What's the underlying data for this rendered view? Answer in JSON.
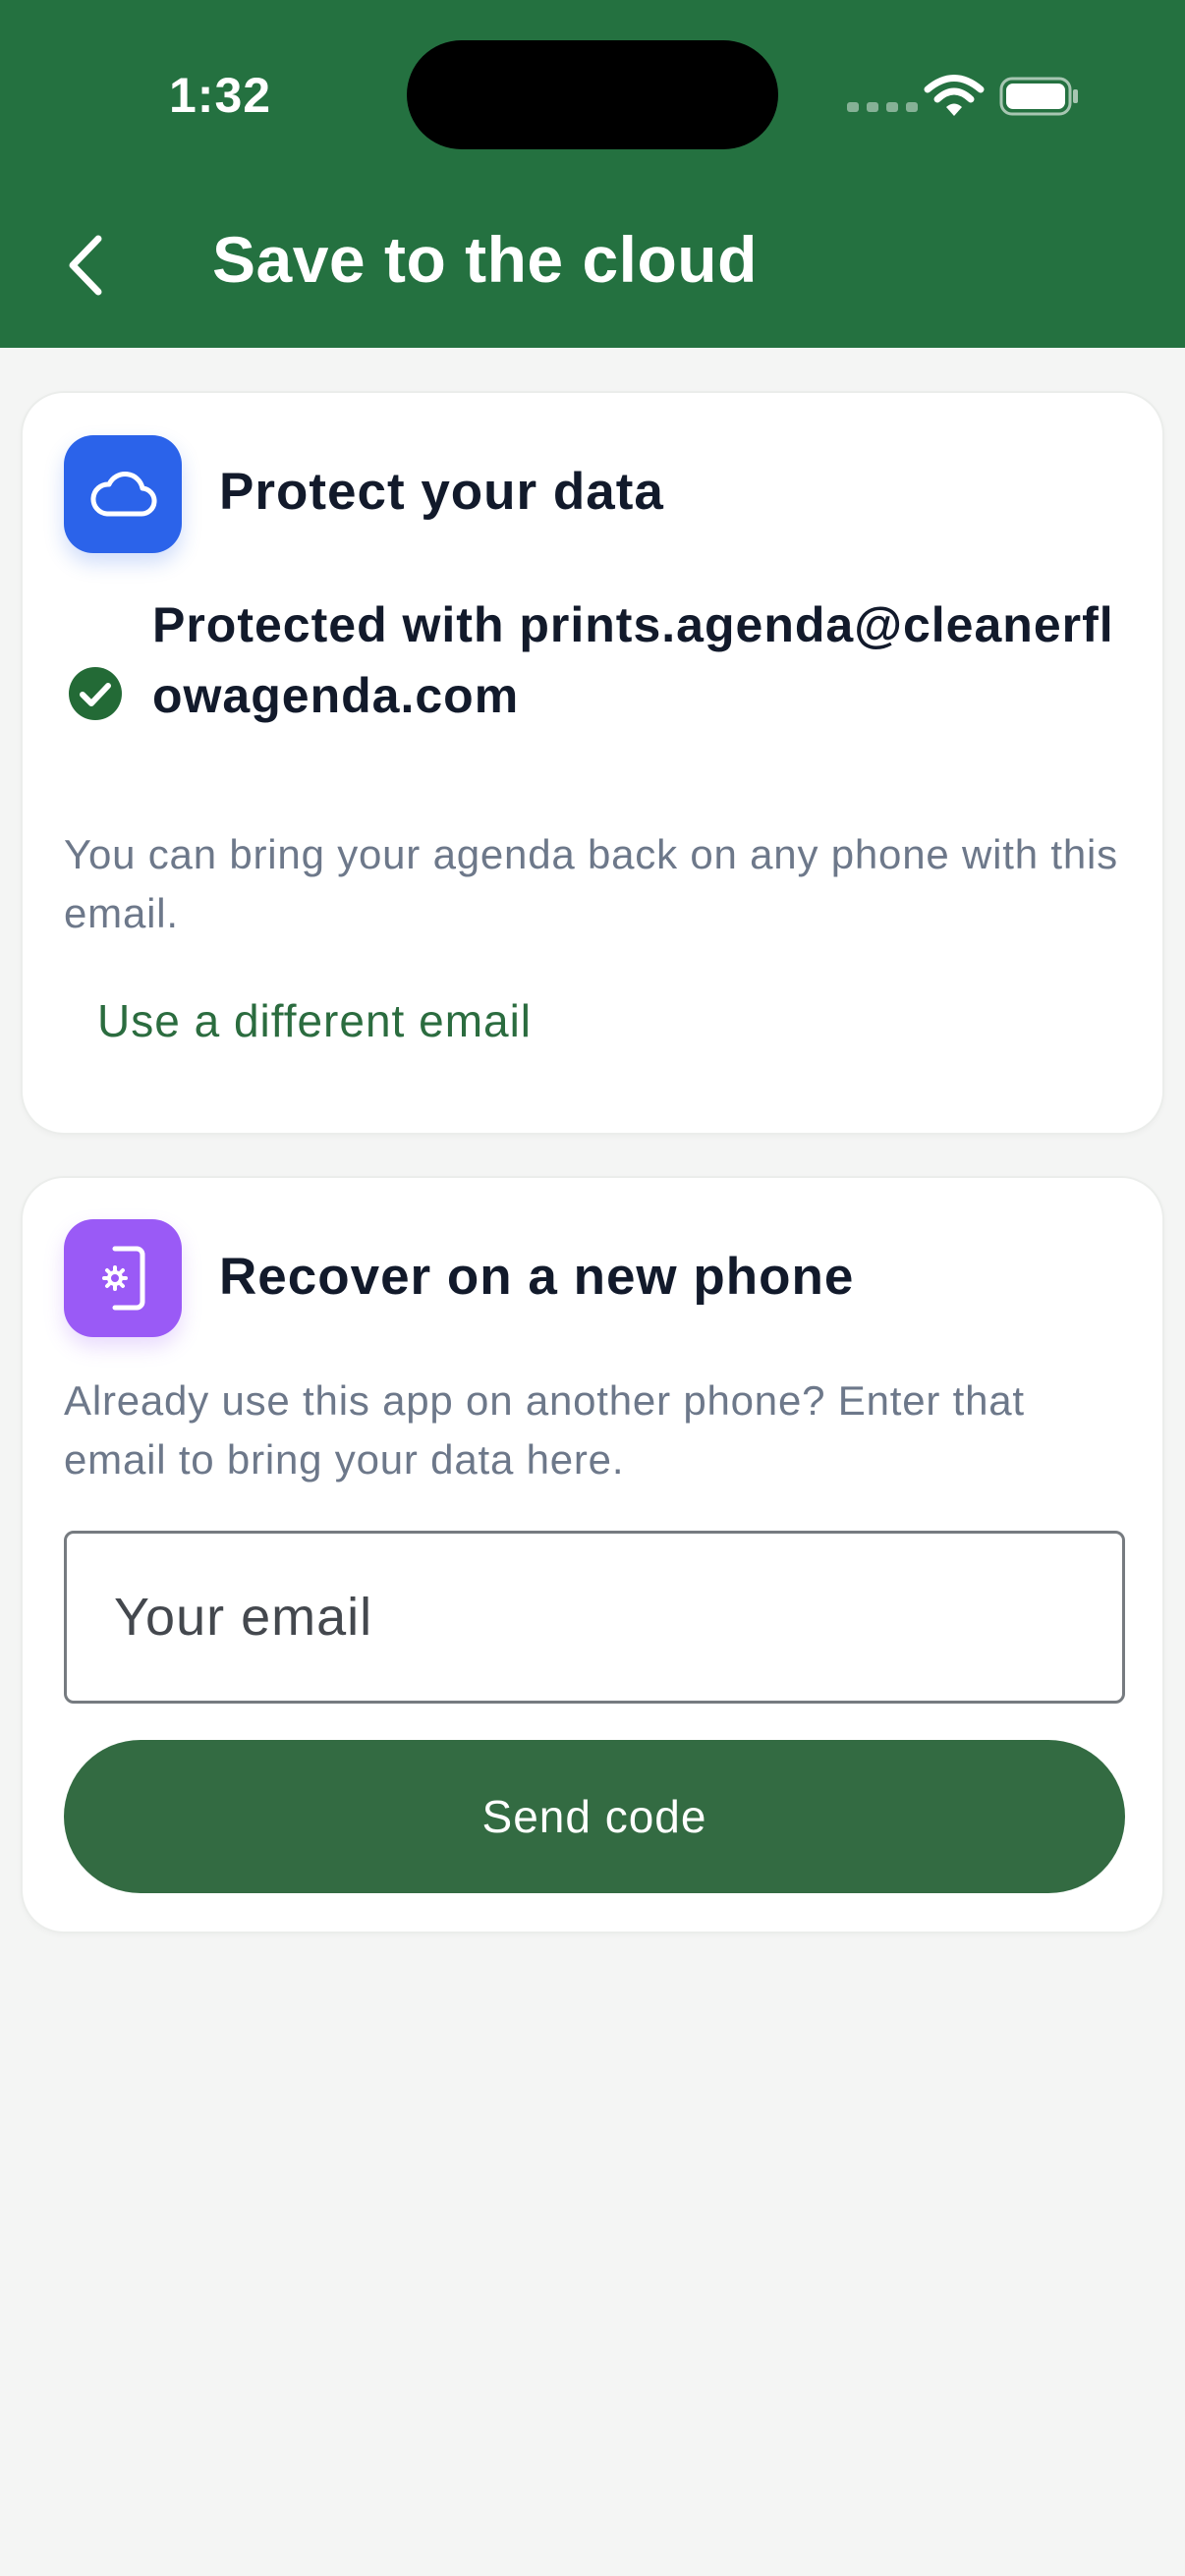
{
  "status_bar": {
    "time": "1:32",
    "icons": [
      "cellular-signal-icon",
      "wifi-icon",
      "battery-icon"
    ]
  },
  "header": {
    "title": "Save to the cloud",
    "back_icon": "chevron-left-icon",
    "background_color": "#247140"
  },
  "protect_card": {
    "icon": "cloud-icon",
    "icon_color": "#2b63ea",
    "title": "Protect your data",
    "status_icon": "check-circle-icon",
    "protected_text": "Protected with prints.agenda@cleanerflowagenda.com",
    "description": "You can bring your agenda back on any phone with this email.",
    "change_email_label": "Use a different email"
  },
  "recover_card": {
    "icon": "phone-settings-icon",
    "icon_color": "#9a5af6",
    "title": "Recover on a new phone",
    "description": "Already use this app on another phone? Enter that email to bring your data here.",
    "email_value": "",
    "email_placeholder": "Your email",
    "send_button_label": "Send code",
    "button_color": "#336b42"
  }
}
